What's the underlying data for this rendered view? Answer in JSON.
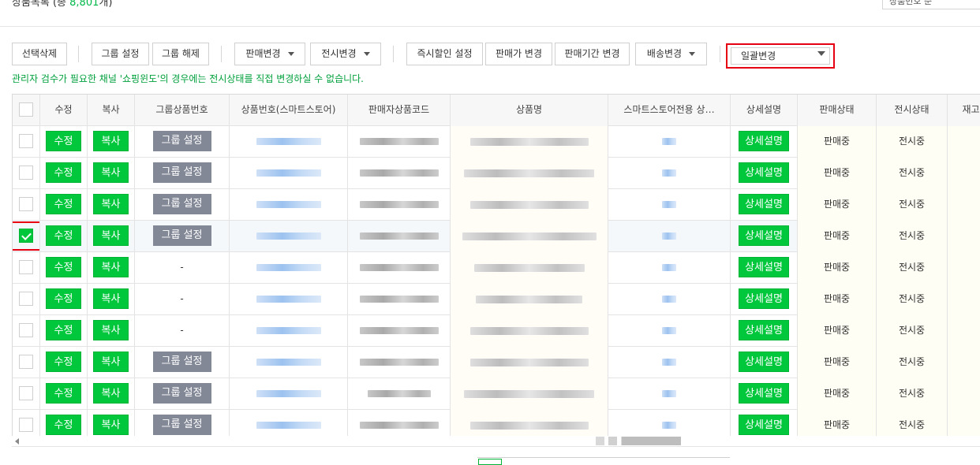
{
  "header": {
    "title_prefix": "상품목록 (총 ",
    "count": "8,801",
    "title_suffix": "개)",
    "sort_label": "상품번호 순"
  },
  "toolbar": {
    "delete_selected": "선택삭제",
    "group_set": "그룹 설정",
    "group_unset": "그룹 해제",
    "sale_change": "판매변경",
    "display_change": "전시변경",
    "instant_discount": "즉시할인 설정",
    "price_change": "판매가 변경",
    "period_change": "판매기간 변경",
    "shipping_change": "배송변경",
    "bulk_change": "일괄변경"
  },
  "notice": "관리자 검수가 필요한 채널 '쇼핑윈도'의 경우에는 전시상태를 직접 변경하실 수 없습니다.",
  "table": {
    "columns": [
      "",
      "수정",
      "복사",
      "그룹상품번호",
      "상품번호(스마트스토어)",
      "판매자상품코드",
      "상품명",
      "스마트스토어전용 상…",
      "상세설명",
      "판매상태",
      "전시상태",
      "재고"
    ],
    "edit_label": "수정",
    "copy_label": "복사",
    "group_label": "그룹 설정",
    "no_group": "-",
    "detail_label": "상세설명",
    "rows": [
      {
        "checked": false,
        "grouped": true,
        "sale_status": "판매중",
        "display_status": "전시중"
      },
      {
        "checked": false,
        "grouped": true,
        "sale_status": "판매중",
        "display_status": "전시중"
      },
      {
        "checked": false,
        "grouped": true,
        "sale_status": "판매중",
        "display_status": "전시중"
      },
      {
        "checked": true,
        "grouped": true,
        "sale_status": "판매중",
        "display_status": "전시중"
      },
      {
        "checked": false,
        "grouped": false,
        "sale_status": "판매중",
        "display_status": "전시중"
      },
      {
        "checked": false,
        "grouped": false,
        "sale_status": "판매중",
        "display_status": "전시중"
      },
      {
        "checked": false,
        "grouped": false,
        "sale_status": "판매중",
        "display_status": "전시중"
      },
      {
        "checked": false,
        "grouped": true,
        "sale_status": "판매중",
        "display_status": "전시중"
      },
      {
        "checked": false,
        "grouped": true,
        "sale_status": "판매중",
        "display_status": "전시중"
      },
      {
        "checked": false,
        "grouped": true,
        "sale_status": "판매중",
        "display_status": "전시중"
      }
    ]
  },
  "colors": {
    "green": "#00c73c",
    "grey_button": "#838897",
    "highlight": "#e60012",
    "notice": "#00a03c"
  }
}
